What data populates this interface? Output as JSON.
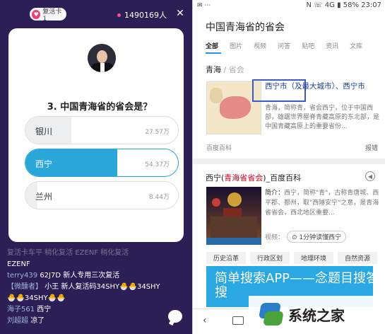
{
  "left": {
    "revive_card": "复活卡 1",
    "viewers": "1490169人",
    "question": "3. 中国青海省的省会是？",
    "options": [
      {
        "label": "银川",
        "count": "27.57万",
        "fill": 0.3,
        "selected": false
      },
      {
        "label": "西宁",
        "count": "54.37万",
        "fill": 0.6,
        "selected": true
      },
      {
        "label": "兰州",
        "count": "8.44万",
        "fill": 0.08,
        "selected": false
      }
    ],
    "chat": {
      "faded": "复活卡车平 稍化复活 EZENF 稍化复活",
      "line0": "EZENF",
      "line1_user": "terry439",
      "line1_text": "62J7D 新人专用三次复活",
      "line2_user": "【微醺者】",
      "line2_text": "小王 新人复活码34SHY🐣🐣34SHY",
      "line3_text": "🐣🐣34SHY🐣🐣",
      "line4_user": "海子561",
      "line4_text": "西宁",
      "line5_user": "刘超超",
      "line5_text": "凉了"
    }
  },
  "right": {
    "status_left": "✉ ⋯",
    "status_right": "N ☏ 4G ▮ 58% 23:07",
    "title": "中国青海省的省会",
    "tabs": [
      "全部",
      "图片",
      "视频",
      "问答",
      "贴吧",
      "资讯",
      "文库"
    ],
    "section": "青海",
    "section_sub": "/ 省会",
    "answer": "西宁市（及最大城市）、西宁市",
    "snippet": "青海，简称青，省会西宁，位于中国西部，雄踞世界屋脊青藏高原的东北部，是中国青藏高原上的重要省份...",
    "source": "百度百科",
    "report": "报错",
    "r2_pre": "西宁(",
    "r2_red": "青海省省会",
    "r2_post": ")_百度百科",
    "r2_lead": "简介：",
    "r2_snip": "西宁，简称\"青\"，古称青唐城、西平郡、鄯州，取\"西陲安宁\"之意，是青海省省会，西北地区重要...",
    "video_label": "视频：",
    "video_btn": "⊙ 1分钟读懂西宁",
    "chips": [
      "历史沿革",
      "行政区划",
      "地理环境",
      "自然资源"
    ],
    "ad": "简单搜索APP——念题目搜答案，秒搜",
    "nav": "‹"
  },
  "watermark": "系统之家"
}
